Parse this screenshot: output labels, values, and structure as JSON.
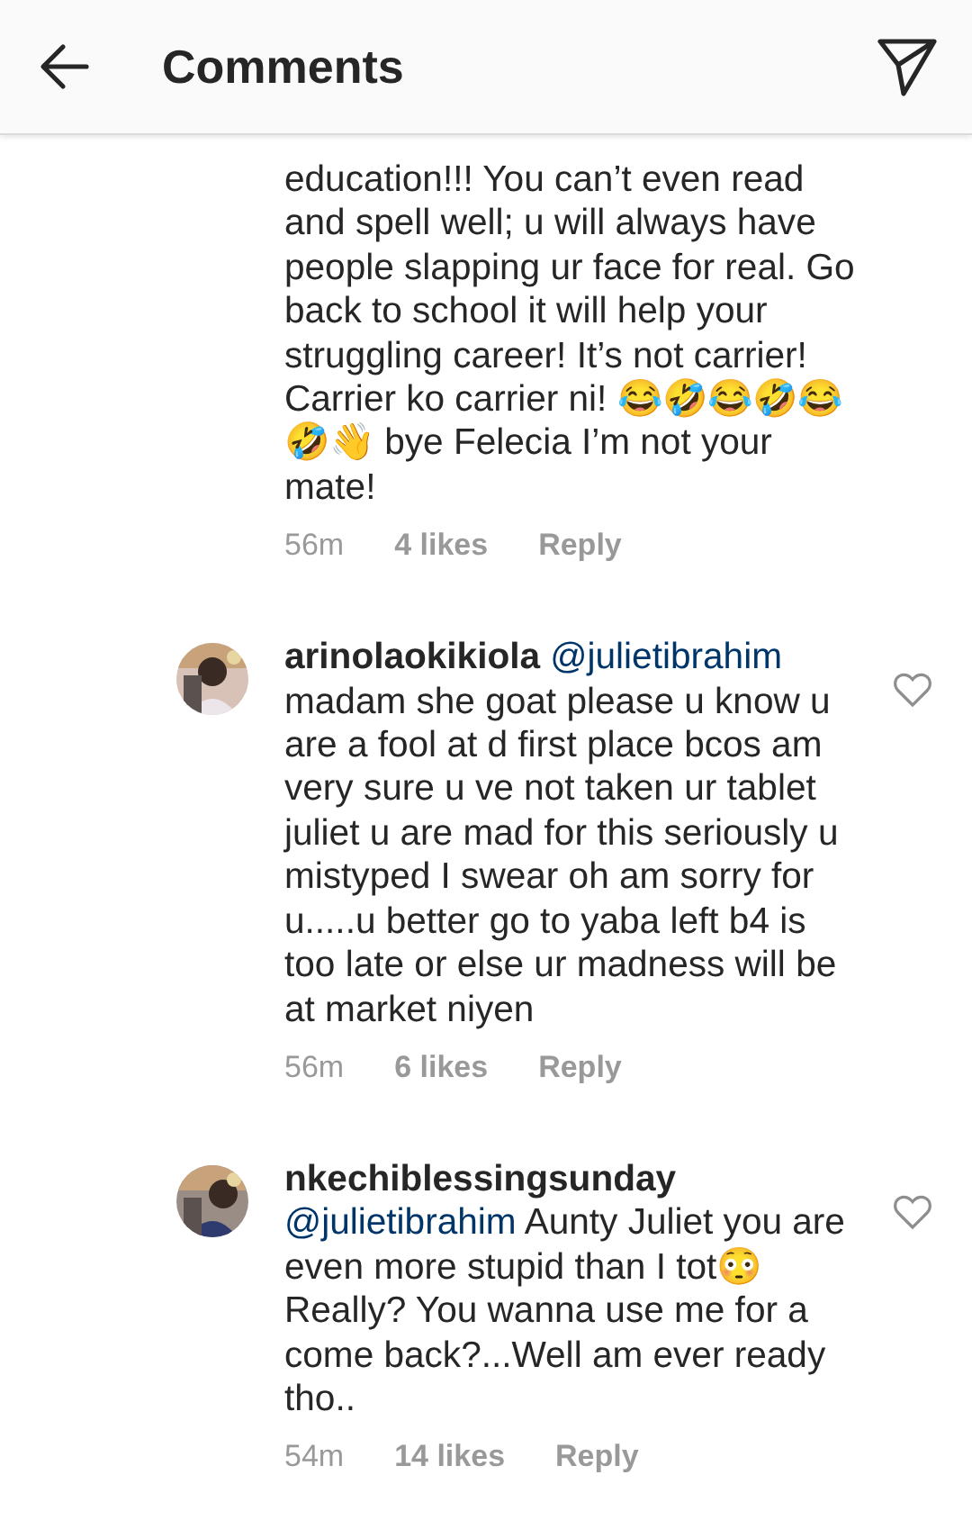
{
  "header": {
    "title": "Comments"
  },
  "comments": [
    {
      "segments": [
        {
          "kind": "text",
          "text": "education!!! You can’t even read and spell well; u will always have people slapping ur face for real. Go back to school it will help your struggling career! It’s not carrier! Carrier ko carrier ni! 😂🤣😂🤣😂🤣👋 bye Felecia I’m not your mate!"
        }
      ],
      "time": "56m",
      "likes": "4 likes",
      "reply": "Reply"
    },
    {
      "liked": false,
      "segments": [
        {
          "kind": "username",
          "text": "arinolaokikiola"
        },
        {
          "kind": "mention",
          "text": "@julietibrahim"
        },
        {
          "kind": "text",
          "text": "madam she goat please u know u are a fool at d first place bcos am very sure u ve not taken ur tablet juliet u are  mad for this seriously u mistyped I swear oh am sorry for u.....u better go to yaba left b4 is too late or else ur madness will be at market niyen"
        }
      ],
      "time": "56m",
      "likes": "6 likes",
      "reply": "Reply"
    },
    {
      "liked": false,
      "segments": [
        {
          "kind": "username",
          "text": "nkechiblessingsunday"
        },
        {
          "kind": "mention",
          "text": "@julietibrahim"
        },
        {
          "kind": "text",
          "text": "Aunty Juliet you are even more stupid than I tot😳 Really? You wanna use me for a come back?...Well am ever ready tho.."
        }
      ],
      "time": "54m",
      "likes": "14 likes",
      "reply": "Reply"
    }
  ]
}
